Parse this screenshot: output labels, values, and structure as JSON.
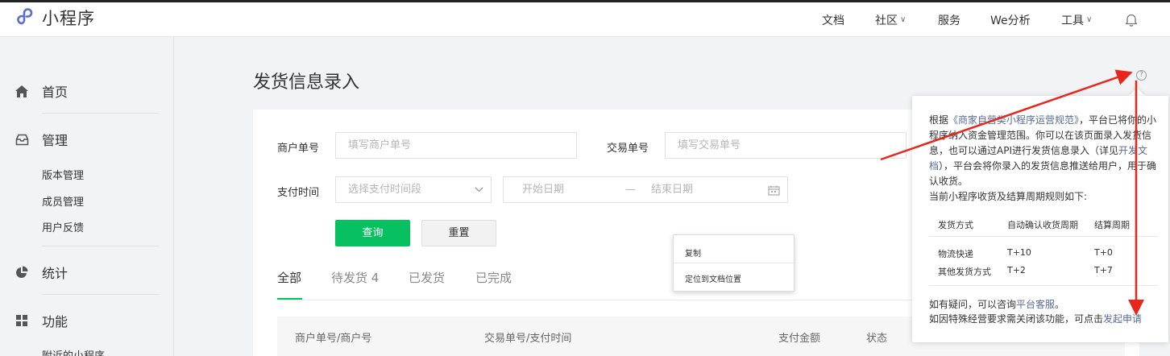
{
  "brand": {
    "name": "小程序"
  },
  "topnav": {
    "items": [
      {
        "label": "文档"
      },
      {
        "label": "社区",
        "has_dropdown": true
      },
      {
        "label": "服务"
      },
      {
        "label": "We分析"
      },
      {
        "label": "工具",
        "has_dropdown": true
      }
    ]
  },
  "sidebar": {
    "home": "首页",
    "manage": "管理",
    "manage_items": [
      "版本管理",
      "成员管理",
      "用户反馈"
    ],
    "stats": "统计",
    "features": "功能",
    "feature_items": [
      "附近的小程序"
    ]
  },
  "page": {
    "title": "发货信息录入"
  },
  "filters": {
    "merchant_no_label": "商户单号",
    "merchant_no_placeholder": "填写商户单号",
    "trade_no_label": "交易单号",
    "trade_no_placeholder": "填写交易单号",
    "pay_time_label": "支付时间",
    "pay_time_select_placeholder": "选择支付时间段",
    "start_date_placeholder": "开始日期",
    "date_separator": "—",
    "end_date_placeholder": "结束日期",
    "query_button": "查询",
    "reset_button": "重置"
  },
  "tabs": [
    {
      "label": "全部",
      "active": true
    },
    {
      "label": "待发货 4",
      "active": false
    },
    {
      "label": "已发货",
      "active": false
    },
    {
      "label": "已完成",
      "active": false
    }
  ],
  "table": {
    "columns": [
      "商户单号/商户号",
      "交易单号/支付时间",
      "支付金额",
      "状态"
    ]
  },
  "context_menu": {
    "items": [
      "复制",
      "定位到文档位置"
    ]
  },
  "help_popover": {
    "p1_before": "根据",
    "p1_link": "《商家自营类小程序运营规范》",
    "p1_middle": "，平台已将你的小程序纳入资金管理范围。你可以在该页面录入发货信息，也可以通过API进行发货信息录入（详见",
    "p1_link2": "开发文档",
    "p1_after": "），平台会将你录入的发货信息推送给用户，用于确认收货。",
    "p2": "当前小程序收货及结算周期规则如下:",
    "table_headers": [
      "发货方式",
      "自动确认收货周期",
      "结算周期"
    ],
    "table_rows": [
      [
        "物流快递",
        "T+10",
        "T+0"
      ],
      [
        "其他发货方式",
        "T+2",
        "T+7"
      ]
    ],
    "foot1_before": "如有疑问，可以咨询",
    "foot1_link": "平台客服",
    "foot1_after": "。",
    "foot2_before": "如因特殊经营要求需关闭该功能，可点击",
    "foot2_link": "发起申请"
  },
  "colors": {
    "accent_green": "#07c160",
    "link_blue": "#576b95",
    "annotation_red": "#e8261c"
  }
}
